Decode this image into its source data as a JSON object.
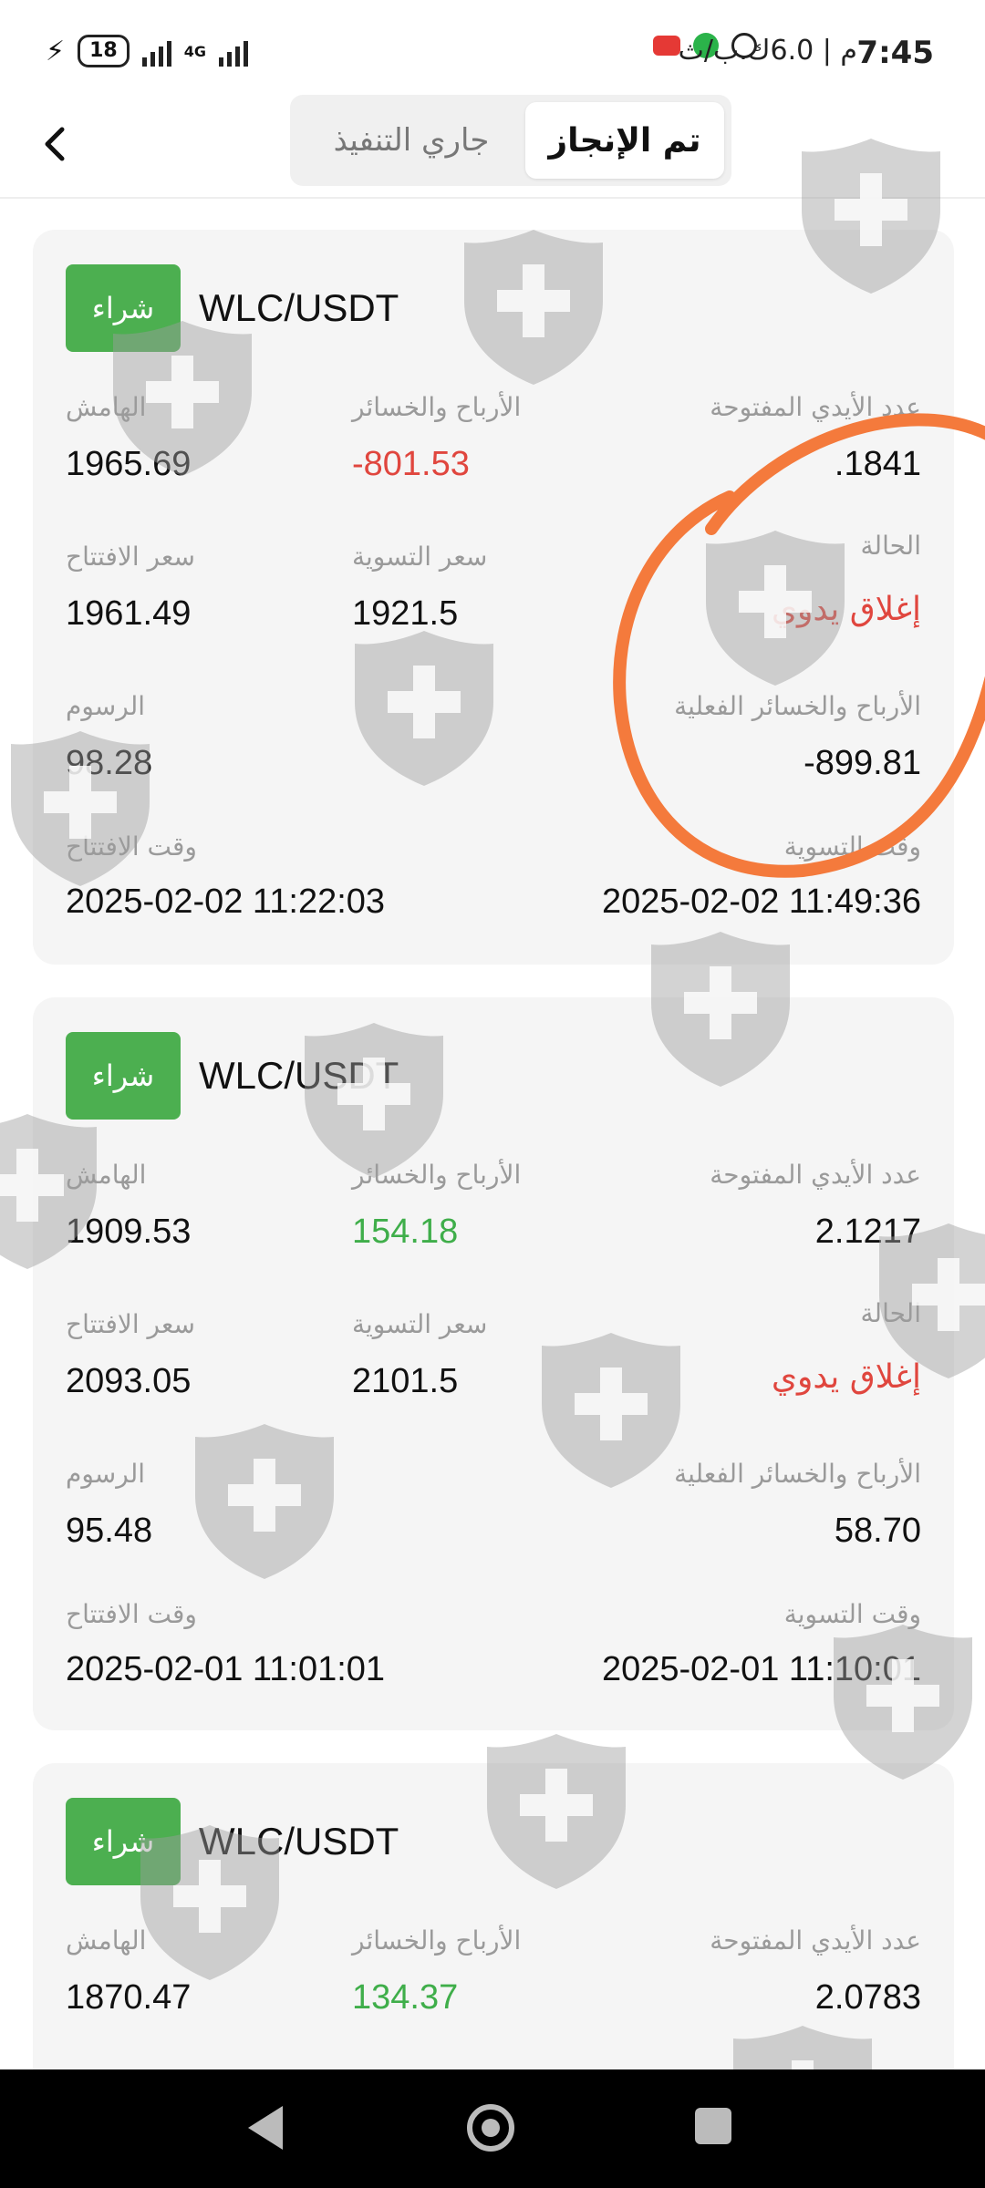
{
  "status_bar": {
    "time": "7:45",
    "speed": "م | 6.0ك.ب/ث",
    "battery": "18",
    "network": "4G"
  },
  "tabs": {
    "active": "تم الإنجاز",
    "inactive": "جاري التنفيذ"
  },
  "orders": [
    {
      "badge": "شراء",
      "pair": "WLC/USDT",
      "labels": {
        "margin": "الهامش",
        "pnl": "الأرباح والخسائر",
        "open_lots": "عدد الأيدي المفتوحة",
        "open_price": "سعر الافتتاح",
        "settle_price": "سعر التسوية",
        "status": "الحالة",
        "fees": "الرسوم",
        "real_pnl": "الأرباح والخسائر الفعلية",
        "open_time": "وقت الافتتاح",
        "settle_time": "وقت التسوية"
      },
      "margin": "1965.69",
      "pnl": "-801.53",
      "open_lots": ".1841",
      "open_price": "1961.49",
      "settle_price": "1921.5",
      "status": "إغلاق يدوي",
      "fees": "98.28",
      "real_pnl": "-899.81",
      "open_time": "2025-02-02 11:22:03",
      "settle_time": "2025-02-02 11:49:36"
    },
    {
      "badge": "شراء",
      "pair": "WLC/USDT",
      "labels": {
        "margin": "الهامش",
        "pnl": "الأرباح والخسائر",
        "open_lots": "عدد الأيدي المفتوحة",
        "open_price": "سعر الافتتاح",
        "settle_price": "سعر التسوية",
        "status": "الحالة",
        "fees": "الرسوم",
        "real_pnl": "الأرباح والخسائر الفعلية",
        "open_time": "وقت الافتتاح",
        "settle_time": "وقت التسوية"
      },
      "margin": "1909.53",
      "pnl": "154.18",
      "open_lots": "2.1217",
      "open_price": "2093.05",
      "settle_price": "2101.5",
      "status": "إغلاق يدوي",
      "fees": "95.48",
      "real_pnl": "58.70",
      "open_time": "2025-02-01 11:01:01",
      "settle_time": "2025-02-01 11:10:01"
    },
    {
      "badge": "شراء",
      "pair": "WLC/USDT",
      "labels": {
        "margin": "الهامش",
        "pnl": "الأرباح والخسائر",
        "open_lots": "عدد الأيدي المفتوحة"
      },
      "margin": "1870.47",
      "pnl": "134.37",
      "open_lots": "2.0783"
    }
  ],
  "colors": {
    "buy": "#4caf50",
    "loss": "#e0463e",
    "profit": "#3fae4a",
    "annotation": "#f47a3c"
  }
}
